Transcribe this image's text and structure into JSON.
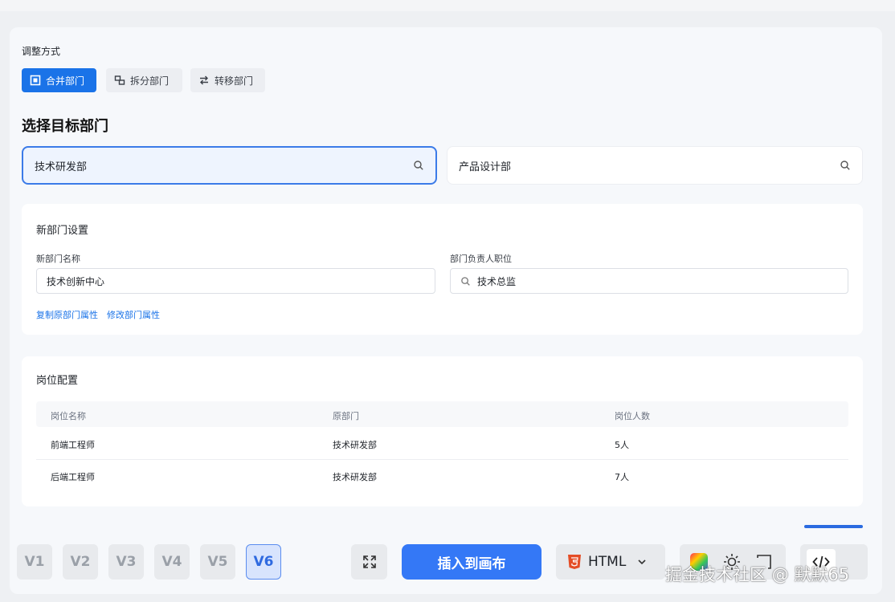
{
  "adjust": {
    "label": "调整方式",
    "modes": [
      {
        "label": "合并部门",
        "icon": "merge-icon",
        "active": true
      },
      {
        "label": "拆分部门",
        "icon": "split-icon",
        "active": false
      },
      {
        "label": "转移部门",
        "icon": "transfer-icon",
        "active": false
      }
    ]
  },
  "target": {
    "title": "选择目标部门",
    "dept_a": "技术研发部",
    "dept_b": "产品设计部"
  },
  "new_dept": {
    "title": "新部门设置",
    "name_label": "新部门名称",
    "name_value": "技术创新中心",
    "leader_label": "部门负责人职位",
    "leader_value": "技术总监",
    "link_copy": "复制原部门属性",
    "link_modify": "修改部门属性"
  },
  "positions": {
    "title": "岗位配置",
    "headers": [
      "岗位名称",
      "原部门",
      "岗位人数"
    ],
    "rows": [
      [
        "前端工程师",
        "技术研发部",
        "5人"
      ],
      [
        "后端工程师",
        "技术研发部",
        "7人"
      ]
    ]
  },
  "toolbar": {
    "versions": [
      "V1",
      "V2",
      "V3",
      "V4",
      "V5",
      "V6"
    ],
    "active_version": "V6",
    "insert_label": "插入到画布",
    "format_label": "HTML"
  },
  "watermark": "掘金技术社区 @ 默默65",
  "colors": {
    "accent": "#1a73e8",
    "primary_button": "#3478f6"
  }
}
